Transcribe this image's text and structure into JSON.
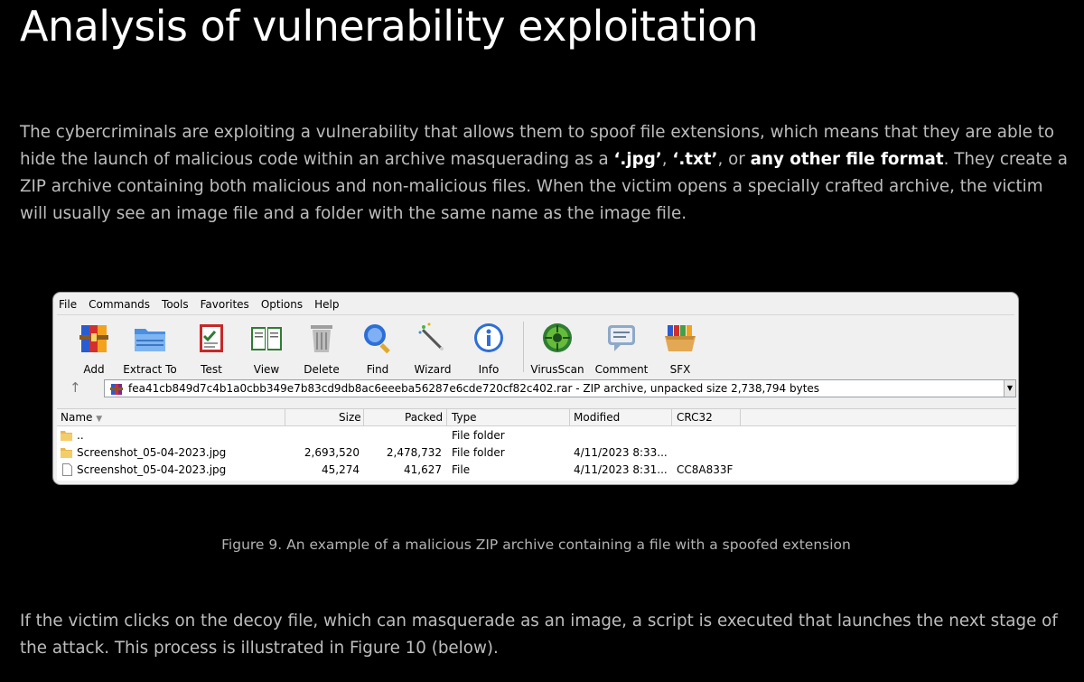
{
  "heading": "Analysis of vulnerability exploitation",
  "paragraph1": {
    "t1": "The cybercriminals are exploiting a vulnerability that allows them to spoof file extensions, which means that they are able to hide the launch of malicious code within an archive masquerading as a ",
    "b1": "‘.jpg’",
    "t2": ", ",
    "b2": "‘.txt’",
    "t3": ", or ",
    "b3": "any other file format",
    "t4": ". They create a ZIP archive containing both malicious and non-malicious files. When the victim opens a specially crafted archive, the victim will usually see an image file and a folder with the same name as the image file."
  },
  "figure": {
    "menu": [
      "File",
      "Commands",
      "Tools",
      "Favorites",
      "Options",
      "Help"
    ],
    "toolbar": [
      {
        "label": "Add",
        "icon": "add-archive-icon"
      },
      {
        "label": "Extract To",
        "icon": "extract-folder-icon"
      },
      {
        "label": "Test",
        "icon": "test-checklist-icon"
      },
      {
        "label": "View",
        "icon": "view-book-icon"
      },
      {
        "label": "Delete",
        "icon": "delete-bin-icon"
      },
      {
        "label": "Find",
        "icon": "find-magnifier-icon"
      },
      {
        "label": "Wizard",
        "icon": "wizard-wand-icon"
      },
      {
        "label": "Info",
        "icon": "info-icon"
      },
      {
        "label": "VirusScan",
        "icon": "virus-scan-icon"
      },
      {
        "label": "Comment",
        "icon": "comment-icon"
      },
      {
        "label": "SFX",
        "icon": "sfx-box-icon"
      }
    ],
    "address": "fea41cb849d7c4b1a0cbb349e7b83cd9db8ac6eeeba56287e6cde720cf82c402.rar - ZIP archive, unpacked size 2,738,794 bytes",
    "columns": {
      "name": "Name",
      "size": "Size",
      "packed": "Packed",
      "type": "Type",
      "modified": "Modified",
      "crc": "CRC32"
    },
    "rows": [
      {
        "name": "..",
        "size": "",
        "packed": "",
        "type": "File folder",
        "modified": "",
        "crc": "",
        "icon": "folder"
      },
      {
        "name": "Screenshot_05-04-2023.jpg",
        "size": "2,693,520",
        "packed": "2,478,732",
        "type": "File folder",
        "modified": "4/11/2023 8:33...",
        "crc": "",
        "icon": "folder"
      },
      {
        "name": "Screenshot_05-04-2023.jpg",
        "size": "45,274",
        "packed": "41,627",
        "type": "File",
        "modified": "4/11/2023 8:31...",
        "crc": "CC8A833F",
        "icon": "file"
      }
    ],
    "caption": "Figure 9. An example of a malicious ZIP archive containing a file with a spoofed extension"
  },
  "paragraph2": "If the victim clicks on the decoy file, which can masquerade as an image, a script is executed that launches the next stage of the attack. This process is illustrated in Figure 10 (below).",
  "colors": {
    "background": "#000000",
    "heading": "#ffffff",
    "body_text": "#bdbdbd"
  }
}
